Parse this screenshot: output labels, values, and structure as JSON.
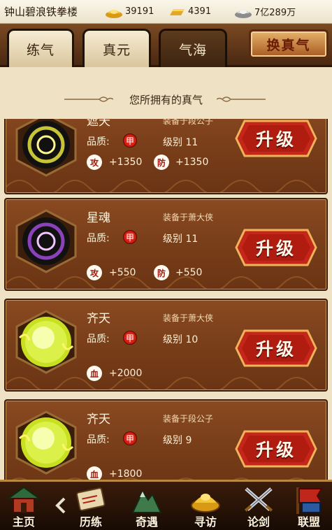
{
  "header": {
    "player_name": "钟山碧浪铁拳楼",
    "gold": "39191",
    "ingot": "4391",
    "silver": "7亿289万"
  },
  "tabs": [
    {
      "label": "练气",
      "active": false
    },
    {
      "label": "真元",
      "active": false
    },
    {
      "label": "气海",
      "active": true
    }
  ],
  "swap_button": "换真气",
  "section_title": "您所拥有的真气",
  "quality_label": "品质:",
  "upgrade_label": "升级",
  "cards": [
    {
      "name": "遮天",
      "equipped": "装备于段公子",
      "quality": "甲",
      "level": "级别 11",
      "orb_color": "yellow-ring",
      "stats": [
        {
          "icon": "攻",
          "value": "+1350"
        },
        {
          "icon": "防",
          "value": "+1350"
        }
      ]
    },
    {
      "name": "星魂",
      "equipped": "装备于萧大侠",
      "quality": "甲",
      "level": "级别 11",
      "orb_color": "purple-ring",
      "stats": [
        {
          "icon": "攻",
          "value": "+550"
        },
        {
          "icon": "防",
          "value": "+550"
        }
      ]
    },
    {
      "name": "齐天",
      "equipped": "装备于萧大侠",
      "quality": "甲",
      "level": "级别 10",
      "orb_color": "lime-glow",
      "stats": [
        {
          "icon": "血",
          "value": "+2000"
        }
      ]
    },
    {
      "name": "齐天",
      "equipped": "装备于段公子",
      "quality": "甲",
      "level": "级别 9",
      "orb_color": "lime-glow",
      "stats": [
        {
          "icon": "血",
          "value": "+1800"
        }
      ]
    }
  ],
  "nav": [
    {
      "label": "主页",
      "icon": "home-icon"
    },
    {
      "label": "历练",
      "icon": "training-scroll-icon"
    },
    {
      "label": "奇遇",
      "icon": "mountain-icon"
    },
    {
      "label": "寻访",
      "icon": "treasure-icon"
    },
    {
      "label": "论剑",
      "icon": "crossed-swords-icon"
    },
    {
      "label": "联盟",
      "icon": "banner-icon"
    }
  ],
  "colors": {
    "parchment": "#efe2c4",
    "card": "#7a3f1a",
    "upgrade_button": "#c4261a",
    "nav": "#2a1408"
  }
}
